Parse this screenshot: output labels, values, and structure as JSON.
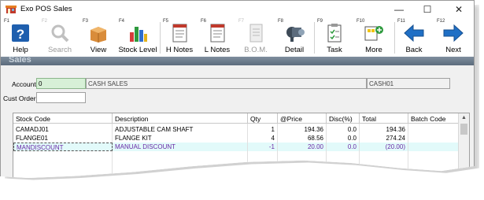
{
  "window": {
    "title": "Exo POS Sales",
    "minimize": "—",
    "maximize": "☐",
    "close": "✕"
  },
  "toolbar": [
    {
      "key": "F1",
      "label": "Help",
      "icon": "help-icon",
      "enabled": true
    },
    {
      "key": "F2",
      "label": "Search",
      "icon": "search-icon",
      "enabled": false
    },
    {
      "key": "F3",
      "label": "View",
      "icon": "view-box-icon",
      "enabled": true
    },
    {
      "key": "F4",
      "label": "Stock Level",
      "icon": "bar-chart-icon",
      "enabled": true
    },
    {
      "key": "F5",
      "label": "H Notes",
      "icon": "notes-icon",
      "enabled": true
    },
    {
      "key": "F6",
      "label": "L Notes",
      "icon": "notes-icon",
      "enabled": true
    },
    {
      "key": "F7",
      "label": "B.O.M.",
      "icon": "bom-icon",
      "enabled": false
    },
    {
      "key": "F8",
      "label": "Detail",
      "icon": "detail-icon",
      "enabled": true
    },
    {
      "key": "F9",
      "label": "Task",
      "icon": "task-icon",
      "enabled": true
    },
    {
      "key": "F10",
      "label": "More",
      "icon": "more-icon",
      "enabled": true
    },
    {
      "key": "F11",
      "label": "Back",
      "icon": "back-arrow-icon",
      "enabled": true
    },
    {
      "key": "F12",
      "label": "Next",
      "icon": "next-arrow-icon",
      "enabled": true
    }
  ],
  "section": {
    "title": "Sales"
  },
  "form": {
    "account_label": "Account",
    "account_value": "0",
    "account_name": "CASH SALES",
    "account_code": "CASH01",
    "cust_order_label": "Cust Order",
    "cust_order_value": ""
  },
  "grid": {
    "columns": [
      "Stock Code",
      "Description",
      "Qty",
      "@Price",
      "Disc(%)",
      "Total",
      "Batch Code"
    ],
    "rows": [
      {
        "stock": "CAMADJ01",
        "desc": "ADJUSTABLE CAM SHAFT",
        "qty": "1",
        "price": "194.36",
        "disc": "0.0",
        "total": "194.36",
        "batch": ""
      },
      {
        "stock": "FLANGE01",
        "desc": "FLANGE KIT",
        "qty": "4",
        "price": "68.56",
        "disc": "0.0",
        "total": "274.24",
        "batch": ""
      },
      {
        "stock": "MANDISCOUNT",
        "desc": "MANUAL DISCOUNT",
        "qty": "-1",
        "price": "20.00",
        "disc": "0.0",
        "total": "(20.00)",
        "batch": ""
      }
    ]
  },
  "colors": {
    "accent_blue": "#1f6fc5",
    "selected_row_bg": "#e2fafa",
    "selected_row_text": "#6a2aa6",
    "account_field_bg": "#d7f0d7"
  }
}
